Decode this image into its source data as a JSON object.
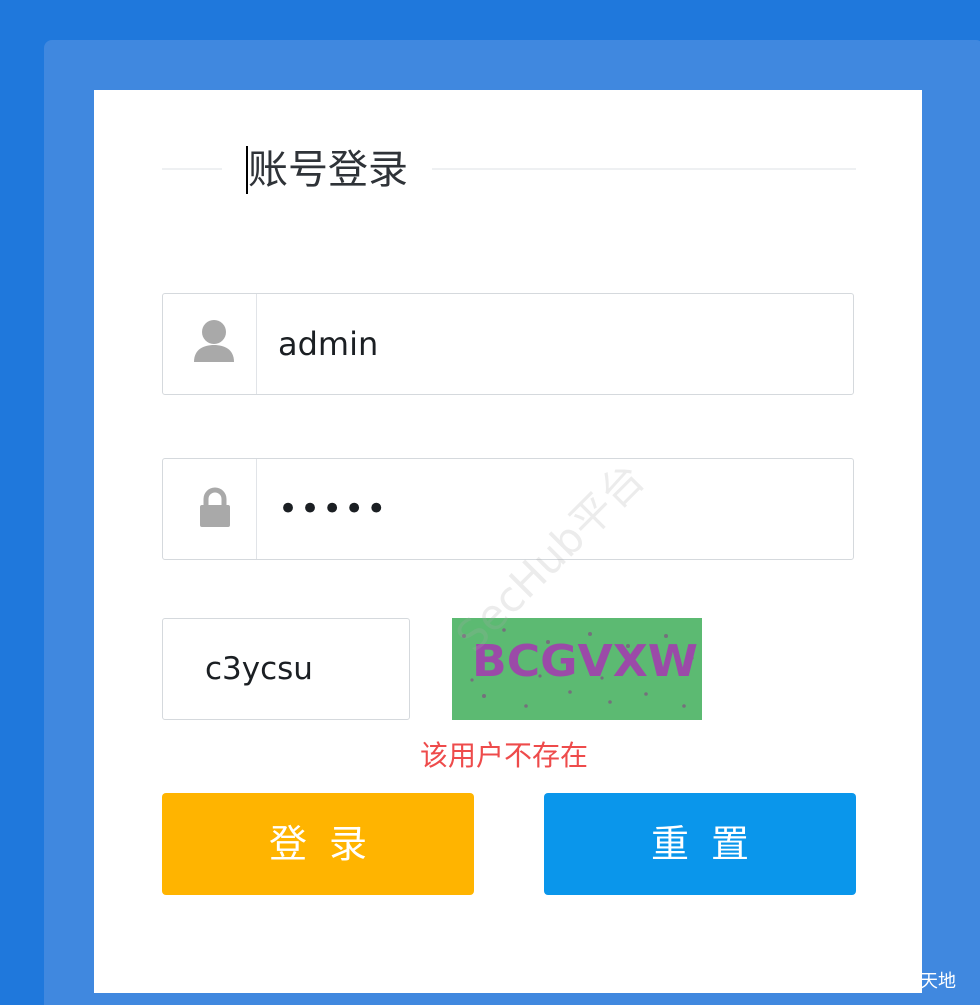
{
  "form": {
    "title": "账号登录",
    "username": {
      "value": "admin",
      "icon": "user-icon"
    },
    "password": {
      "value": "•••••",
      "icon": "lock-icon"
    },
    "captcha": {
      "input_value": "c3ycsu",
      "image_text": "BCGVXW"
    },
    "error_message": "该用户不存在",
    "login_button": "登录",
    "reset_button": "重置"
  },
  "watermark": "SecHub平台",
  "corner_mark": "天地",
  "colors": {
    "page_background": "#1f78dc",
    "panel_background": "#4088df",
    "captcha_background": "#5cba72",
    "captcha_text": "#9b4aa8",
    "error_text": "#ee4b4b",
    "login_button": "#ffb400",
    "reset_button": "#0a96eb"
  }
}
